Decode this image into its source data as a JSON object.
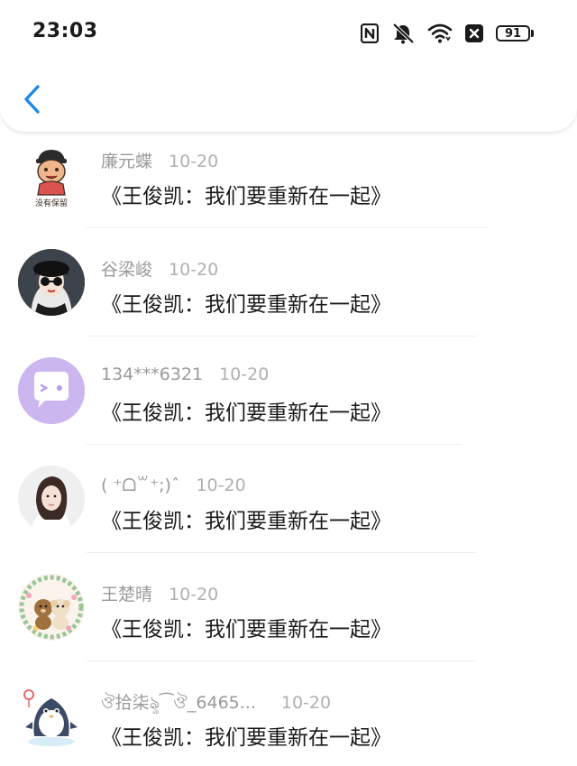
{
  "status_bar": {
    "time": "23:03",
    "battery_level": "91",
    "icons": [
      "nfc-icon",
      "mute-icon",
      "wifi-icon",
      "close-box-icon",
      "battery-icon"
    ]
  },
  "header": {
    "back_icon": "chevron-left-icon",
    "accent_color": "#1e88e5"
  },
  "comments": [
    {
      "username": "廉元蝶",
      "date": "10-20",
      "content": "《王俊凯：我们要重新在一起》",
      "avatar_badge_text": "没有保留"
    },
    {
      "username": "谷梁峻",
      "date": "10-20",
      "content": "《王俊凯：我们要重新在一起》"
    },
    {
      "username": "134***6321",
      "date": "10-20",
      "content": "《王俊凯：我们要重新在一起》"
    },
    {
      "username": "( ⁺ᗝ꒳⁺;)ˆ",
      "date": "10-20",
      "content": "《王俊凯：我们要重新在一起》"
    },
    {
      "username": "王楚晴",
      "date": "10-20",
      "content": "《王俊凯：我们要重新在一起》"
    },
    {
      "username": "ঔ拾柒ৡ⁀ঔ_6465...",
      "date": "10-20",
      "content": "《王俊凯：我们要重新在一起》"
    }
  ]
}
